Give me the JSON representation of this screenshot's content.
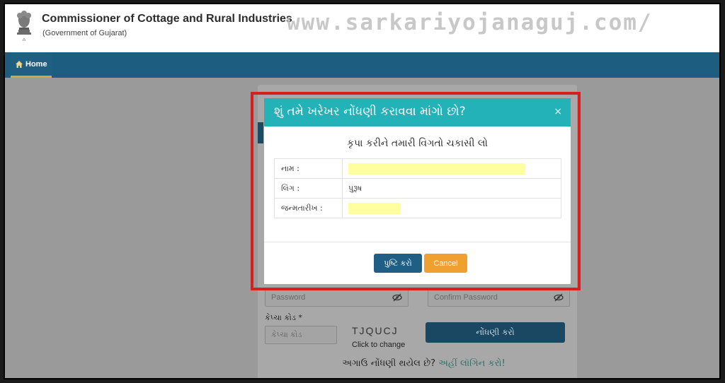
{
  "header": {
    "title": "Commissioner of Cottage and Rural Industries",
    "subtitle": "(Government of Gujarat)",
    "watermark": "www.sarkariyojanaguj.com/"
  },
  "nav": {
    "home_label": "Home"
  },
  "form": {
    "password_placeholder": "Password",
    "confirm_password_placeholder": "Confirm Password",
    "captcha_label": "કેપ્ચા કોડ *",
    "captcha_placeholder": "કેપ્ચા કોડ",
    "captcha_code": "TJQUCJ",
    "captcha_hint": "Click to change",
    "register_button": "નોંધણી કરો",
    "already_registered": "અગાઉ નોંધણી થયેલ છે?",
    "login_link": "અહીં લૉગિન કરો!"
  },
  "modal": {
    "title": "શું તમે ખરેખર નોંધણી કરાવવા માંગો છો?",
    "close_symbol": "×",
    "subtitle": "કૃપા કરીને તમારી વિગતો ચકાસી લો",
    "rows": [
      {
        "label": "નામ :",
        "value": ""
      },
      {
        "label": "લિંગ :",
        "value": "પુરૂષ"
      },
      {
        "label": "જન્મતારીખ :",
        "value": ""
      }
    ],
    "confirm_button": "પુષ્ટિ કરો",
    "cancel_button": "Cancel"
  },
  "colors": {
    "nav_bg": "#1d5e80",
    "modal_header": "#22b2b8",
    "confirm_btn": "#1f5f85",
    "cancel_btn": "#f0a031",
    "highlight": "#d71f1f",
    "redaction": "#ffff9e"
  },
  "icons": {
    "home": "home-icon",
    "emblem": "state-emblem-icon",
    "eye_slash": "eye-slash-icon",
    "close": "close-icon"
  }
}
